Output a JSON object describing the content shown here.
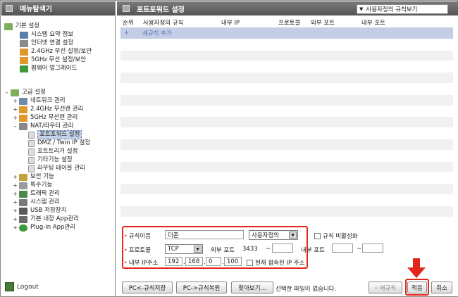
{
  "sidebar": {
    "title": "메뉴탐색기",
    "groups": [
      {
        "label": "기본 설정",
        "items": [
          "시스템 요약 정보",
          "인터넷 연결 설정",
          "2.4GHz 무선 설정/보안",
          "5GHz 무선 설정/보안",
          "펌웨어 업그레이드"
        ]
      },
      {
        "label": "고급 설정",
        "items": [
          "네트워크 관리",
          "2.4GHz 무선랜 관리",
          "5GHz 무선랜 관리",
          "NAT/라우터 관리"
        ]
      }
    ],
    "nat_children": [
      "포트포워드 설정",
      "DMZ / Twin IP 설정",
      "포트트리거 설정",
      "기타기능 설정",
      "라우팅 테이블 관리"
    ],
    "more": [
      "보안 기능",
      "특수기능",
      "트래픽 관리",
      "시스템 관리",
      "USB 저장장치",
      "기본 내장 App관리",
      "Plug-in App관리"
    ],
    "logout": "Logout"
  },
  "main": {
    "title": "포트포워드 설정",
    "view_select": "사용자정의 규칙보기",
    "columns": [
      "순위",
      "사용자정의 규칙",
      "내부 IP",
      "프로토콜",
      "외부 포트",
      "내부 포트"
    ],
    "add_rule_icon": "+",
    "add_rule_label": "새규칙 추가"
  },
  "form": {
    "rule_name_label": "규칙이름",
    "rule_name_value": "더존",
    "rule_type": "사용자정의",
    "disable_label": "규칙 비활성화",
    "protocol_label": "프로토콜",
    "protocol_value": "TCP",
    "ext_port_label": "외부 포트",
    "ext_port_from": "3433",
    "ext_port_sep": "~",
    "ext_port_to": "",
    "int_port_label": "내부 포트",
    "int_port_from": "",
    "int_port_sep": "~",
    "int_port_to": "",
    "ip_label": "내부 IP주소",
    "ip": [
      "192",
      "168",
      "0",
      "100"
    ],
    "current_ip_label": "현재 접속된 IP 주소"
  },
  "bottom": {
    "save_pc": "PC<-규칙저장",
    "restore_pc": "PC->규칙복원",
    "browse": "찾아보기...",
    "file_status": "선택한 파일이 없습니다.",
    "new_rule": "새규칙",
    "apply": "적용",
    "cancel": "취소"
  },
  "colors": {
    "header": "#5f5f5f",
    "highlight": "#e3261c",
    "add_row": "#c3cde6"
  }
}
